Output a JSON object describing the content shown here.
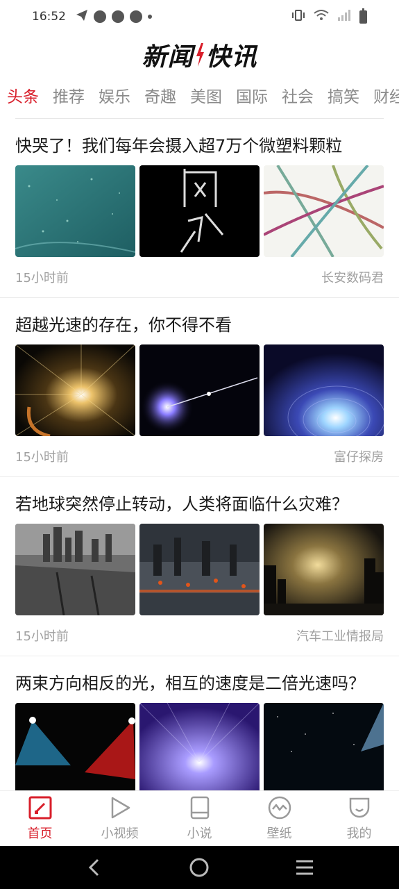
{
  "status_bar": {
    "time": "16:52",
    "left_icons": [
      "telegram-send-icon",
      "notification-icon",
      "notification-icon",
      "notification-icon",
      "dot-icon"
    ],
    "right_icons": [
      "vibrate-icon",
      "wifi-icon",
      "signal-icon",
      "battery-icon"
    ]
  },
  "header": {
    "logo_left": "新闻",
    "logo_right": "快讯",
    "accent_color": "#d81e2a"
  },
  "tabs": [
    {
      "label": "头条",
      "active": true
    },
    {
      "label": "推荐",
      "active": false
    },
    {
      "label": "娱乐",
      "active": false
    },
    {
      "label": "奇趣",
      "active": false
    },
    {
      "label": "美图",
      "active": false
    },
    {
      "label": "国际",
      "active": false
    },
    {
      "label": "社会",
      "active": false
    },
    {
      "label": "搞笑",
      "active": false
    },
    {
      "label": "财经",
      "active": false
    }
  ],
  "articles": [
    {
      "title": "快哭了！我们每年会摄入超7万个微塑料颗粒",
      "time": "15小时前",
      "source": "长安数码君",
      "images": [
        "water-microplastics-image",
        "calligraphy-image",
        "plastic-fibers-image"
      ]
    },
    {
      "title": "超越光速的存在，你不得不看",
      "time": "15小时前",
      "source": "富仔探房",
      "images": [
        "starburst-image",
        "light-particle-image",
        "wormhole-image"
      ]
    },
    {
      "title": "若地球突然停止转动，人类将面临什么灾难？",
      "time": "15小时前",
      "source": "汽车工业情报局",
      "images": [
        "ruined-city-image",
        "burning-city-image",
        "stormy-ruins-image"
      ]
    },
    {
      "title": "两束方向相反的光，相互的速度是二倍光速吗？",
      "time": "",
      "source": "",
      "images": [
        "spotlights-image",
        "light-tunnel-image",
        "space-beam-image"
      ]
    }
  ],
  "bottom_nav": [
    {
      "label": "首页",
      "icon": "home-icon",
      "active": true
    },
    {
      "label": "小视频",
      "icon": "play-icon",
      "active": false
    },
    {
      "label": "小说",
      "icon": "book-icon",
      "active": false
    },
    {
      "label": "壁纸",
      "icon": "wallpaper-icon",
      "active": false
    },
    {
      "label": "我的",
      "icon": "profile-icon",
      "active": false
    }
  ],
  "system_nav": [
    "back-icon",
    "home-circle-icon",
    "recents-icon"
  ]
}
